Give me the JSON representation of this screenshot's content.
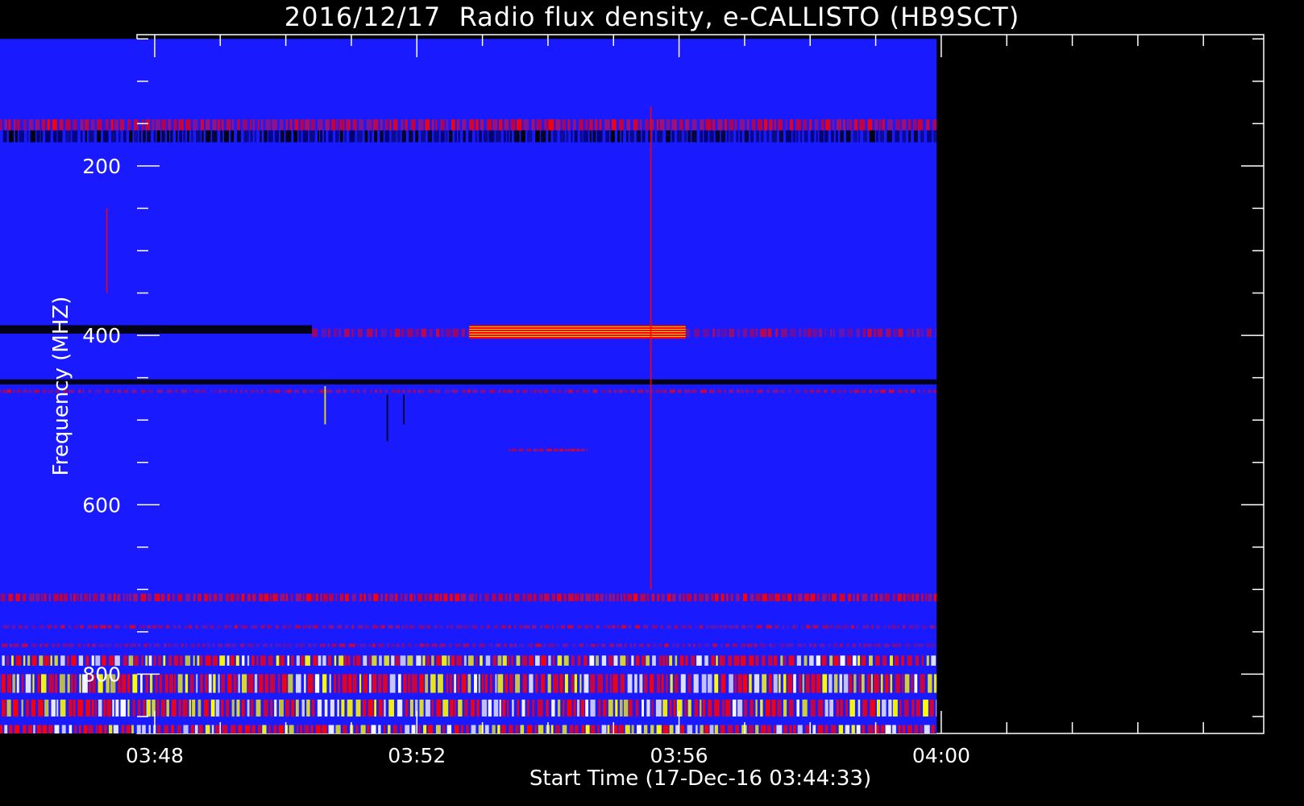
{
  "chart_data": {
    "type": "heatmap",
    "title": "2016/12/17  Radio flux density, e-CALLISTO (HB9SCT)",
    "xlabel": "Start Time (17-Dec-16 03:44:33)",
    "ylabel": "Frequency (MHZ)",
    "x_range_minutes": [
      3.73,
      20.92
    ],
    "y_range_mhz": [
      45,
      870
    ],
    "x_major_ticks": [
      {
        "minutes": 4,
        "label": "03:48"
      },
      {
        "minutes": 8,
        "label": "03:52"
      },
      {
        "minutes": 12,
        "label": "03:56"
      },
      {
        "minutes": 16,
        "label": "04:00"
      }
    ],
    "y_major_ticks": [
      {
        "mhz": 200,
        "label": "200"
      },
      {
        "mhz": 400,
        "label": "400"
      },
      {
        "mhz": 600,
        "label": "600"
      },
      {
        "mhz": 800,
        "label": "800"
      }
    ],
    "data_extent": {
      "x_minutes": [
        0.3,
        15.93
      ],
      "y_mhz": [
        50,
        870
      ]
    },
    "colormap": [
      "#000000",
      "#0000ff",
      "#ff0000",
      "#ffff00",
      "#ffffff"
    ],
    "background_color": "#1a1aff",
    "features": [
      {
        "kind": "band",
        "f_low": 145,
        "f_high": 158,
        "x_start": 0.3,
        "x_end": 15.93,
        "intensity": "red",
        "pattern": "dashed"
      },
      {
        "kind": "band",
        "f_low": 158,
        "f_high": 172,
        "x_start": 0.3,
        "x_end": 15.93,
        "intensity": "dark",
        "pattern": "dashed"
      },
      {
        "kind": "band",
        "f_low": 388,
        "f_high": 398,
        "x_start": 0.3,
        "x_end": 6.4,
        "intensity": "dark",
        "pattern": "solid"
      },
      {
        "kind": "band",
        "f_low": 392,
        "f_high": 402,
        "x_start": 6.4,
        "x_end": 15.93,
        "intensity": "red",
        "pattern": "faint"
      },
      {
        "kind": "block",
        "f_low": 388,
        "f_high": 404,
        "x_start": 8.8,
        "x_end": 12.1,
        "intensity": "hot"
      },
      {
        "kind": "band",
        "f_low": 452,
        "f_high": 458,
        "x_start": 0.3,
        "x_end": 15.93,
        "intensity": "dark",
        "pattern": "solid"
      },
      {
        "kind": "band",
        "f_low": 464,
        "f_high": 468,
        "x_start": 0.3,
        "x_end": 15.93,
        "intensity": "red",
        "pattern": "faint"
      },
      {
        "kind": "band",
        "f_low": 534,
        "f_high": 537,
        "x_start": 9.4,
        "x_end": 10.6,
        "intensity": "red",
        "pattern": "dashed"
      },
      {
        "kind": "band",
        "f_low": 705,
        "f_high": 714,
        "x_start": 0.3,
        "x_end": 15.93,
        "intensity": "red",
        "pattern": "dashed"
      },
      {
        "kind": "band",
        "f_low": 742,
        "f_high": 746,
        "x_start": 0.3,
        "x_end": 15.93,
        "intensity": "red",
        "pattern": "faint"
      },
      {
        "kind": "band",
        "f_low": 764,
        "f_high": 768,
        "x_start": 0.3,
        "x_end": 15.93,
        "intensity": "red",
        "pattern": "faint"
      },
      {
        "kind": "band",
        "f_low": 778,
        "f_high": 790,
        "x_start": 0.3,
        "x_end": 15.93,
        "intensity": "hot",
        "pattern": "dashed"
      },
      {
        "kind": "band",
        "f_low": 800,
        "f_high": 822,
        "x_start": 0.3,
        "x_end": 15.93,
        "intensity": "hot",
        "pattern": "dashed"
      },
      {
        "kind": "band",
        "f_low": 830,
        "f_high": 850,
        "x_start": 0.3,
        "x_end": 15.93,
        "intensity": "hot",
        "pattern": "dashed"
      },
      {
        "kind": "band",
        "f_low": 860,
        "f_high": 870,
        "x_start": 0.3,
        "x_end": 15.93,
        "intensity": "hot",
        "pattern": "dashed"
      },
      {
        "kind": "vline",
        "x": 3.27,
        "f_low": 250,
        "f_high": 350,
        "intensity": "red"
      },
      {
        "kind": "vline",
        "x": 11.57,
        "f_low": 130,
        "f_high": 700,
        "intensity": "red"
      },
      {
        "kind": "vline",
        "x": 6.6,
        "f_low": 460,
        "f_high": 505,
        "intensity": "hot"
      },
      {
        "kind": "vline",
        "x": 7.55,
        "f_low": 470,
        "f_high": 525,
        "intensity": "dark"
      },
      {
        "kind": "vline",
        "x": 7.8,
        "f_low": 470,
        "f_high": 505,
        "intensity": "dark"
      }
    ]
  }
}
